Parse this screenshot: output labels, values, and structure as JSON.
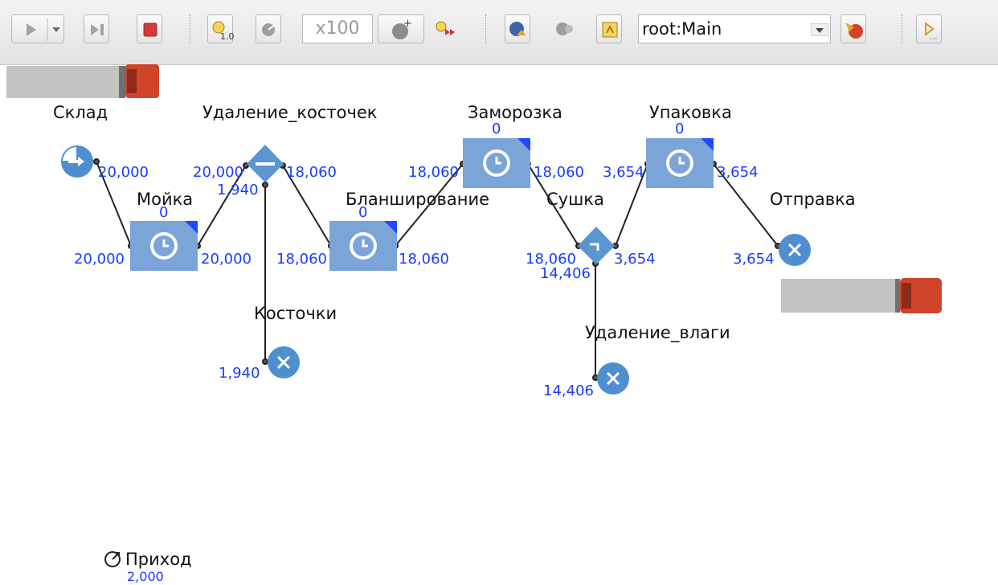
{
  "toolbar": {
    "speed": "x100",
    "agent": "root:Main"
  },
  "colors": {
    "block": "#7ba4d8",
    "link_count": "#1a3cff",
    "stop": "#d23b3b",
    "truck": "#d0442a"
  },
  "icons": [
    "play-icon",
    "dropdown-arrow-icon",
    "step-icon",
    "stop-icon",
    "model-time-icon",
    "realtime-icon",
    "virtual-time-icon",
    "fast-forward-icon",
    "experiment-icon",
    "agent-icon",
    "up-icon",
    "navigate-icon",
    "camera-icon",
    "console-icon",
    "clock-icon",
    "close-icon",
    "source-arrow-icon",
    "split-icon",
    "truck-icon",
    "event-icon"
  ],
  "blocks": {
    "source": {
      "name": "Склад",
      "out": "20,000"
    },
    "wash": {
      "name": "Мойка",
      "count": "0",
      "in": "20,000",
      "out": "20,000"
    },
    "pit_split": {
      "name": "Удаление_косточек",
      "in": "20,000",
      "out1": "18,060",
      "out2": "1,940"
    },
    "pits_sink": {
      "name": "Косточки",
      "in": "1,940"
    },
    "blanch": {
      "name": "Бланширование",
      "count": "0",
      "in": "18,060",
      "out": "18,060"
    },
    "freeze": {
      "name": "Заморозка",
      "count": "0",
      "in": "18,060",
      "out": "18,060"
    },
    "dry": {
      "name": "Сушка",
      "in": "18,060",
      "out1": "3,654",
      "out2": "14,406"
    },
    "moisture_sink": {
      "name": "Удаление_влаги",
      "in": "14,406"
    },
    "pack": {
      "name": "Упаковка",
      "count": "0",
      "in": "3,654",
      "out": "3,654"
    },
    "ship": {
      "name": "Отправка",
      "in": "3,654"
    }
  },
  "event": {
    "name": "Приход",
    "value": "2,000"
  }
}
